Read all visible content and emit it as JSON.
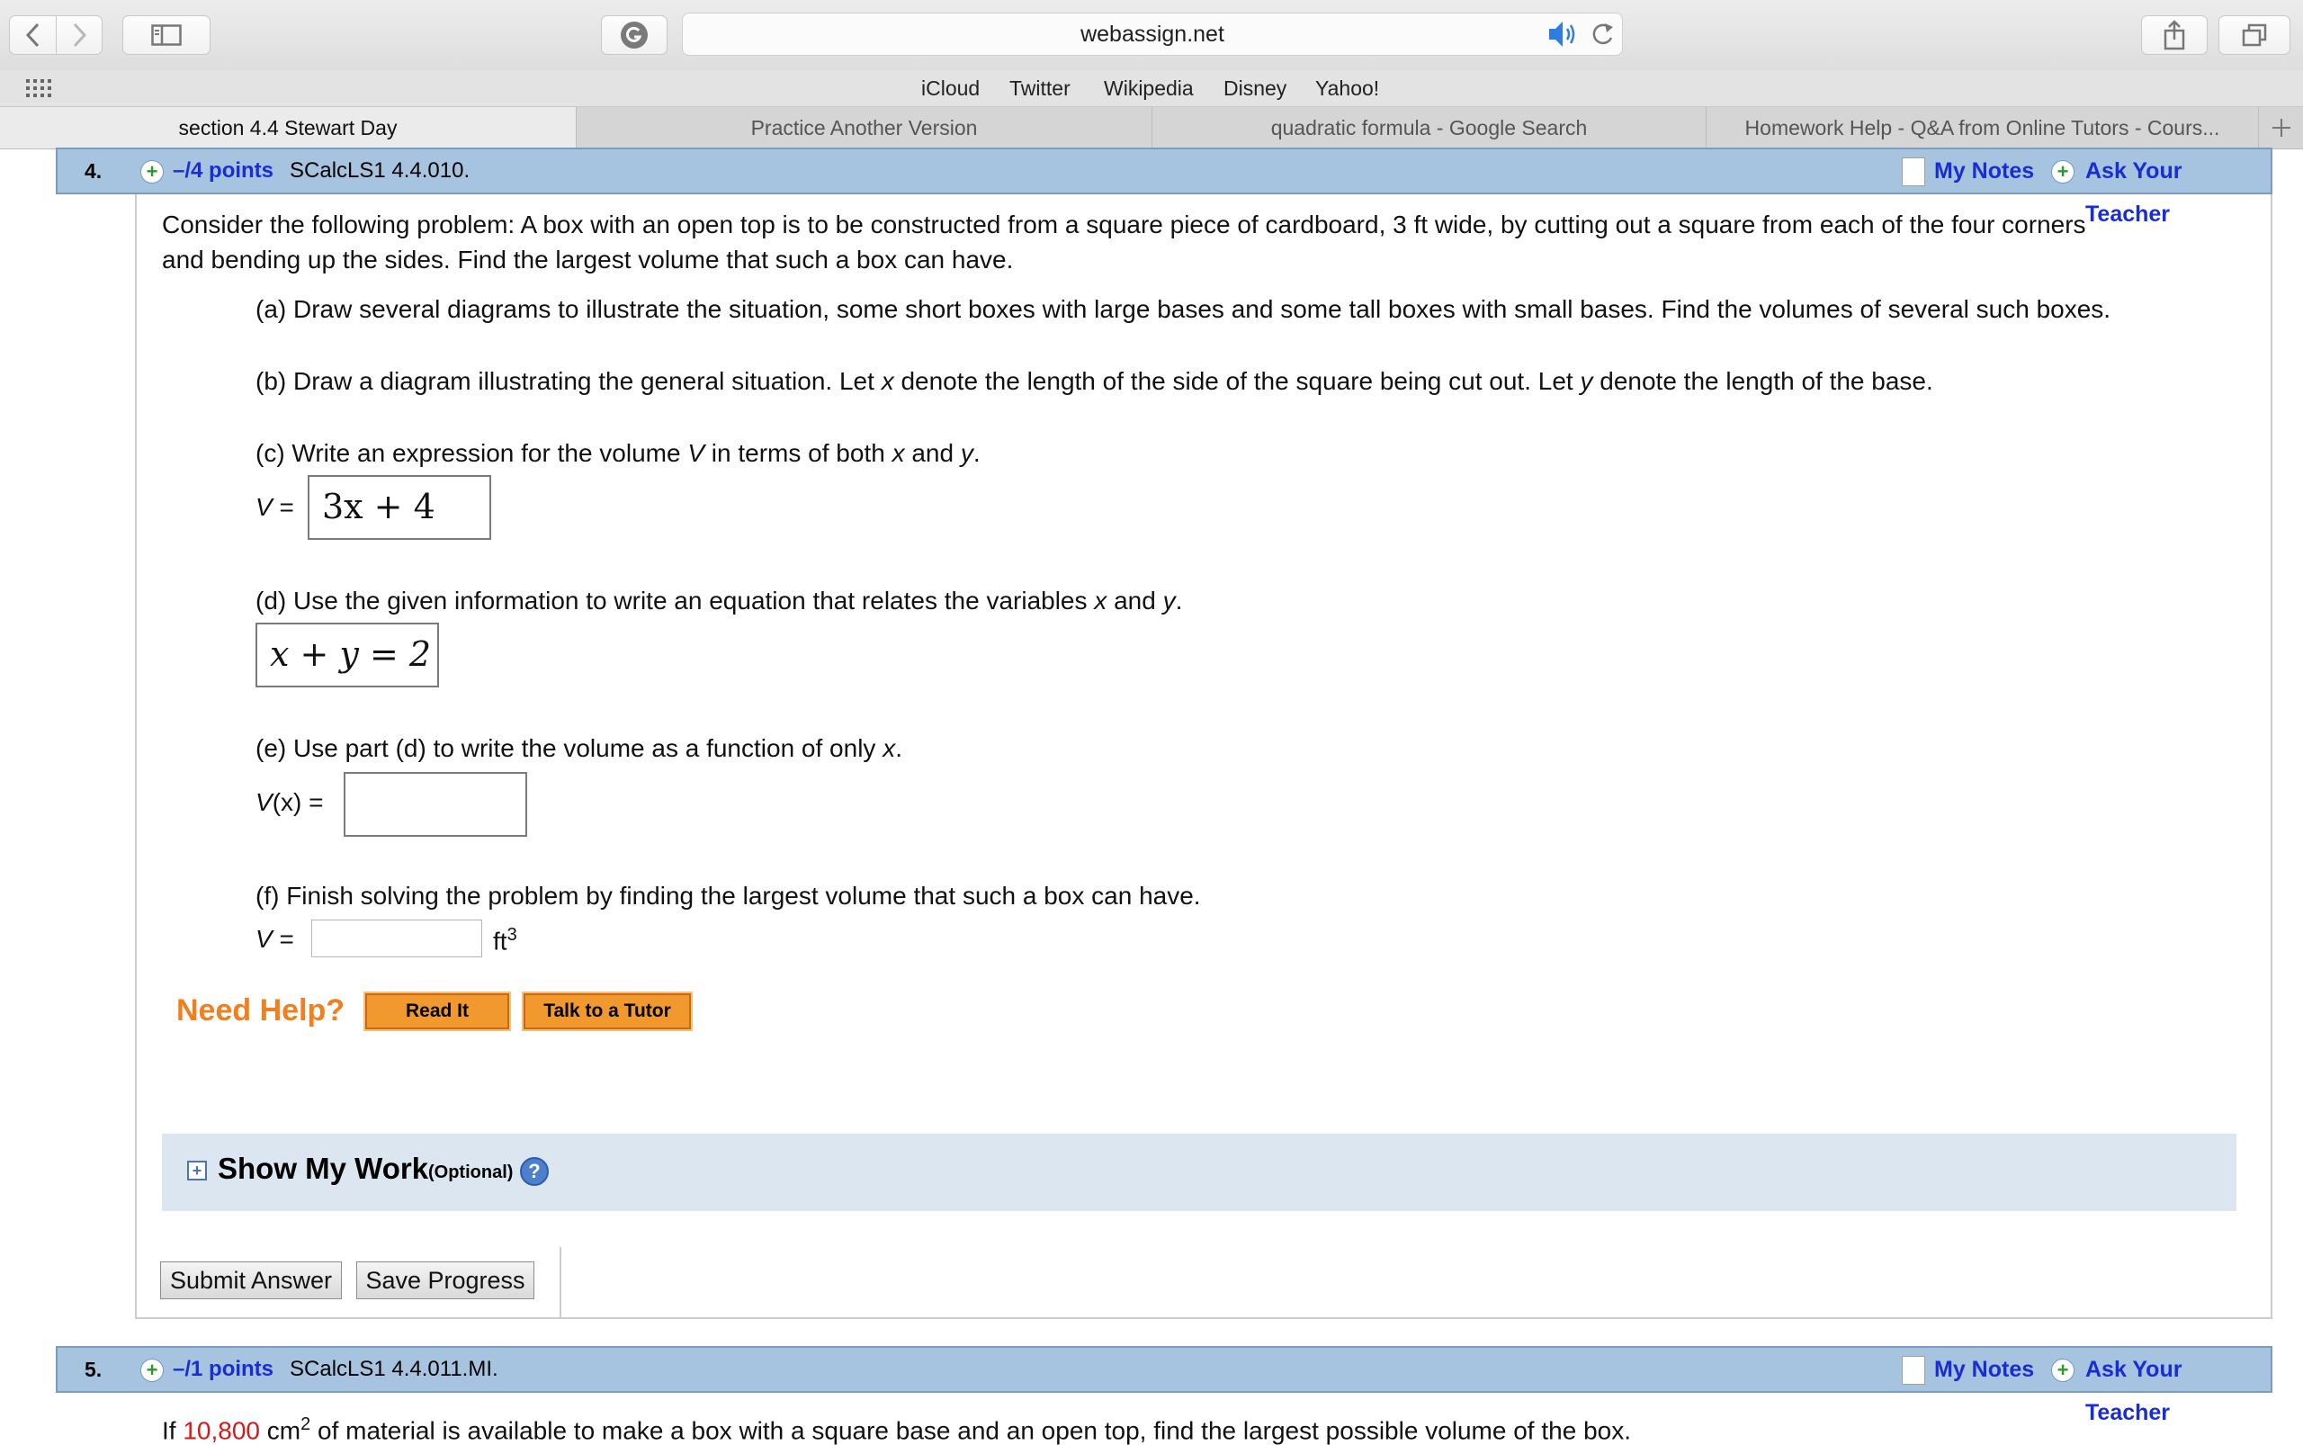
{
  "browser": {
    "url": "webassign.net",
    "favorites": [
      "iCloud",
      "Twitter",
      "Wikipedia",
      "Disney",
      "Yahoo!"
    ],
    "tabs": [
      {
        "label": "section 4.4 Stewart Day",
        "active": true
      },
      {
        "label": "Practice Another Version",
        "active": false
      },
      {
        "label": "quadratic formula - Google Search",
        "active": false
      },
      {
        "label": "Homework Help - Q&A from Online Tutors - Cours...",
        "active": false
      }
    ]
  },
  "question4": {
    "number": "4.",
    "points": "–/4 points",
    "id": "SCalcLS1 4.4.010.",
    "my_notes": "My Notes",
    "ask_teacher": "Ask Your Teacher",
    "intro_line1": "Consider the following problem: A box with an open top is to be constructed from a square piece of cardboard, 3 ft wide, by cutting out a square from each of the four corners",
    "intro_line2": "and bending up the sides. Find the largest volume that such a box can have.",
    "part_a": "(a) Draw several diagrams to illustrate the situation, some short boxes with large bases and some tall boxes with small bases. Find the volumes of several such boxes.",
    "part_b_1": "(b) Draw a diagram illustrating the general situation. Let ",
    "part_b_x": "x",
    "part_b_2": " denote the length of the side of the square being cut out. Let ",
    "part_b_y": "y",
    "part_b_3": " denote the length of the base.",
    "part_c_1": "(c) Write an expression for the volume ",
    "part_c_V": "V",
    "part_c_2": " in terms of both ",
    "part_c_x": "x",
    "part_c_3": " and ",
    "part_c_y": "y",
    "part_c_4": ".",
    "part_c_label_V": "V",
    "part_c_label_eq": " =",
    "part_c_answer": "3x + 4",
    "part_d_1": "(d) Use the given information to write an equation that relates the variables ",
    "part_d_x": "x",
    "part_d_2": " and ",
    "part_d_y": "y",
    "part_d_3": ".",
    "part_d_answer": "x + y = 2",
    "part_e_1": "(e) Use part (d) to write the volume as a function of only ",
    "part_e_x": "x",
    "part_e_2": ".",
    "part_e_label_V": "V",
    "part_e_label_rest": "(x) =",
    "part_e_answer": "",
    "part_f": "(f) Finish solving the problem by finding the largest volume that such a box can have.",
    "part_f_label_V": "V",
    "part_f_label_eq": " =",
    "part_f_answer": "",
    "part_f_unit": "ft",
    "part_f_unit_sup": "3",
    "need_help": "Need Help?",
    "read_it": "Read It",
    "talk_tutor": "Talk to a Tutor",
    "show_my_work": "Show My Work",
    "optional": "(Optional)",
    "help_icon": "?",
    "submit": "Submit Answer",
    "save": "Save Progress"
  },
  "question5": {
    "number": "5.",
    "points": "–/1 points",
    "id": "SCalcLS1 4.4.011.MI.",
    "my_notes": "My Notes",
    "ask_teacher": "Ask Your Teacher",
    "text_1": "If ",
    "text_value": "10,800",
    "text_2": " cm",
    "text_sup": "2",
    "text_3": " of material is available to make a box with a square base and an open top, find the largest possible volume of the box."
  },
  "icons": {
    "back": "chevron-left-icon",
    "forward": "chevron-right-icon",
    "sidebar": "sidebar-icon",
    "extension": "grammarly-icon",
    "audio": "speaker-icon",
    "reload": "reload-icon",
    "share": "share-icon",
    "tabs": "tabs-overview-icon",
    "favorites_grid": "grid-icon",
    "new_tab": "plus-icon"
  },
  "colors": {
    "question_bar": "#a6c4e0",
    "link_blue": "#1a2dd4",
    "need_help_orange": "#f07f1e",
    "show_work_bg": "#dbe6f0",
    "value_red": "#d61a1a"
  }
}
